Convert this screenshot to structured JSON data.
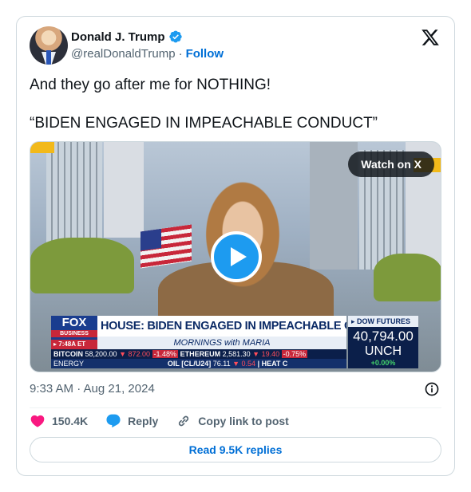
{
  "author": {
    "name": "Donald J. Trump",
    "handle": "@realDonaldTrump",
    "separator": "·",
    "follow_label": "Follow"
  },
  "icons": {
    "verified": "verified-badge-icon",
    "x": "x-logo-icon",
    "play": "play-icon",
    "info": "info-icon",
    "like": "heart-icon",
    "reply": "reply-bubble-icon",
    "link": "link-icon"
  },
  "colors": {
    "accent": "#1d9bf0",
    "link": "#006fd6",
    "like": "#f91880",
    "muted": "#536471"
  },
  "tweet": {
    "line1": "And they go after me for NOTHING!",
    "line2": "“BIDEN ENGAGED IN IMPEACHABLE CONDUCT”"
  },
  "media": {
    "watch_label": "Watch on X",
    "chyron": {
      "logo": "FOX",
      "logo_sub": "BUSINESS",
      "time": "▸ 7:48A ET",
      "headline": "HOUSE: BIDEN ENGAGED IN IMPEACHABLE CONDUCT",
      "show": "MORNINGS with MARIA",
      "ticker_row1": {
        "bitcoin_label": "BITCOIN",
        "bitcoin_value": "58,200.00",
        "bitcoin_change": "▼ 872.00",
        "bitcoin_pct": "-1.48%",
        "ethereum_label": "ETHEREUM",
        "ethereum_value": "2,581.30",
        "ethereum_change": "▼ 19.40",
        "ethereum_pct": "-0.75%"
      },
      "ticker_row2": {
        "energy_label": "ENERGY",
        "oil_label": "OIL [CL/U24]",
        "oil_value": "76.11",
        "oil_change": "▼ 0.54",
        "heat_label": "| HEAT C"
      },
      "dow_label": "▸ DOW FUTURES",
      "dow_value": "40,794.00",
      "dow_unch": "UNCH",
      "dow_change": "+0.00%"
    }
  },
  "meta": {
    "timestamp": "9:33 AM · Aug 21, 2024"
  },
  "actions": {
    "likes": "150.4K",
    "reply_label": "Reply",
    "copy_label": "Copy link to post"
  },
  "replies_label": "Read 9.5K replies"
}
